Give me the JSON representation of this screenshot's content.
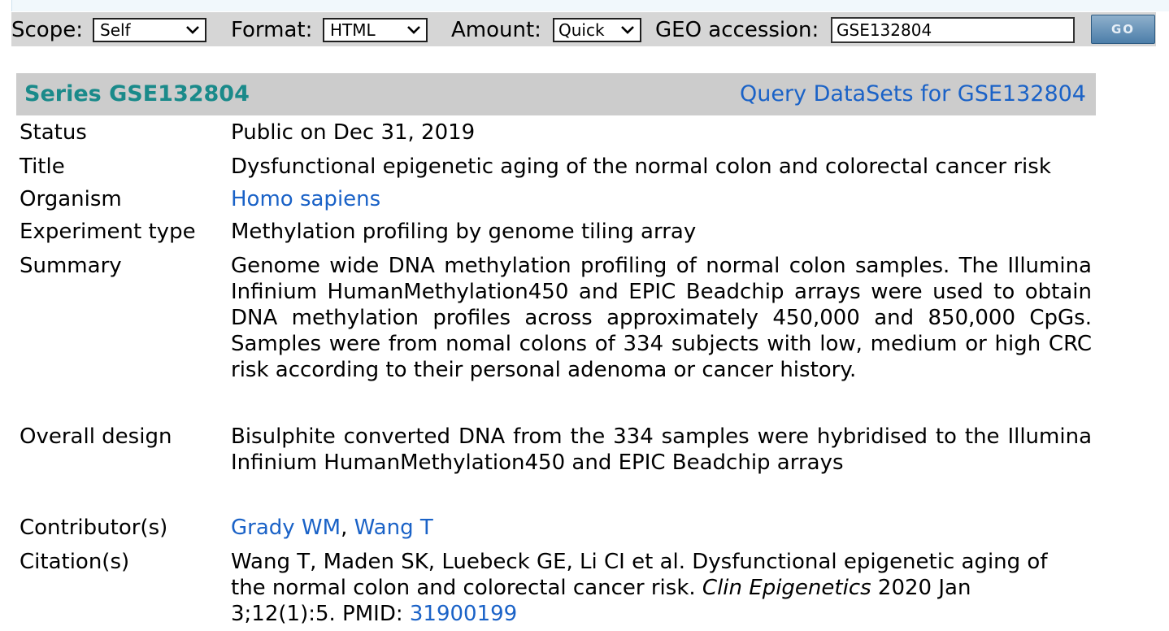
{
  "toolbar": {
    "scope_label": "Scope:",
    "scope_value": "Self",
    "format_label": "Format:",
    "format_value": "HTML",
    "amount_label": "Amount:",
    "amount_value": "Quick",
    "geo_label": "GEO accession:",
    "geo_value": "GSE132804",
    "go_label": "GO"
  },
  "series": {
    "title": "Series GSE132804",
    "query_link": "Query DataSets for GSE132804"
  },
  "fields": {
    "status": {
      "label": "Status",
      "value": "Public on Dec 31, 2019"
    },
    "title": {
      "label": "Title",
      "value": "Dysfunctional epigenetic aging of the normal colon and colorectal cancer risk"
    },
    "organism": {
      "label": "Organism",
      "value": "Homo sapiens"
    },
    "experiment_type": {
      "label": "Experiment type",
      "value": "Methylation profiling by genome tiling array"
    },
    "summary": {
      "label": "Summary",
      "value": "Genome wide DNA methylation profiling of normal colon samples. The Illumina Infinium HumanMethylation450 and EPIC Beadchip arrays were used to obtain DNA methylation profiles across approximately 450,000 and 850,000 CpGs. Samples were from nomal colons of 334 subjects with low, medium or high CRC risk according to their personal adenoma or cancer history."
    },
    "overall_design": {
      "label": "Overall design",
      "value": "Bisulphite converted DNA from the 334 samples were hybridised to the Illumina Infinium HumanMethylation450 and EPIC Beadchip arrays"
    },
    "contributors": {
      "label": "Contributor(s)",
      "names": [
        "Grady WM",
        "Wang T"
      ],
      "separator": ", "
    },
    "citation": {
      "label": "Citation(s)",
      "text_before": "Wang T, Maden SK, Luebeck GE, Li CI et al. Dysfunctional epigenetic aging of the normal colon and colorectal cancer risk.",
      "journal": "Clin Epigenetics",
      "text_after": "2020 Jan 3;12(1):5. PMID:",
      "pmid": "31900199"
    }
  },
  "colors": {
    "series_title": "#1a8a8a",
    "link": "#1a62c7",
    "header_bg": "#cccccc",
    "toolbar_bg": "#d6d6d6"
  }
}
